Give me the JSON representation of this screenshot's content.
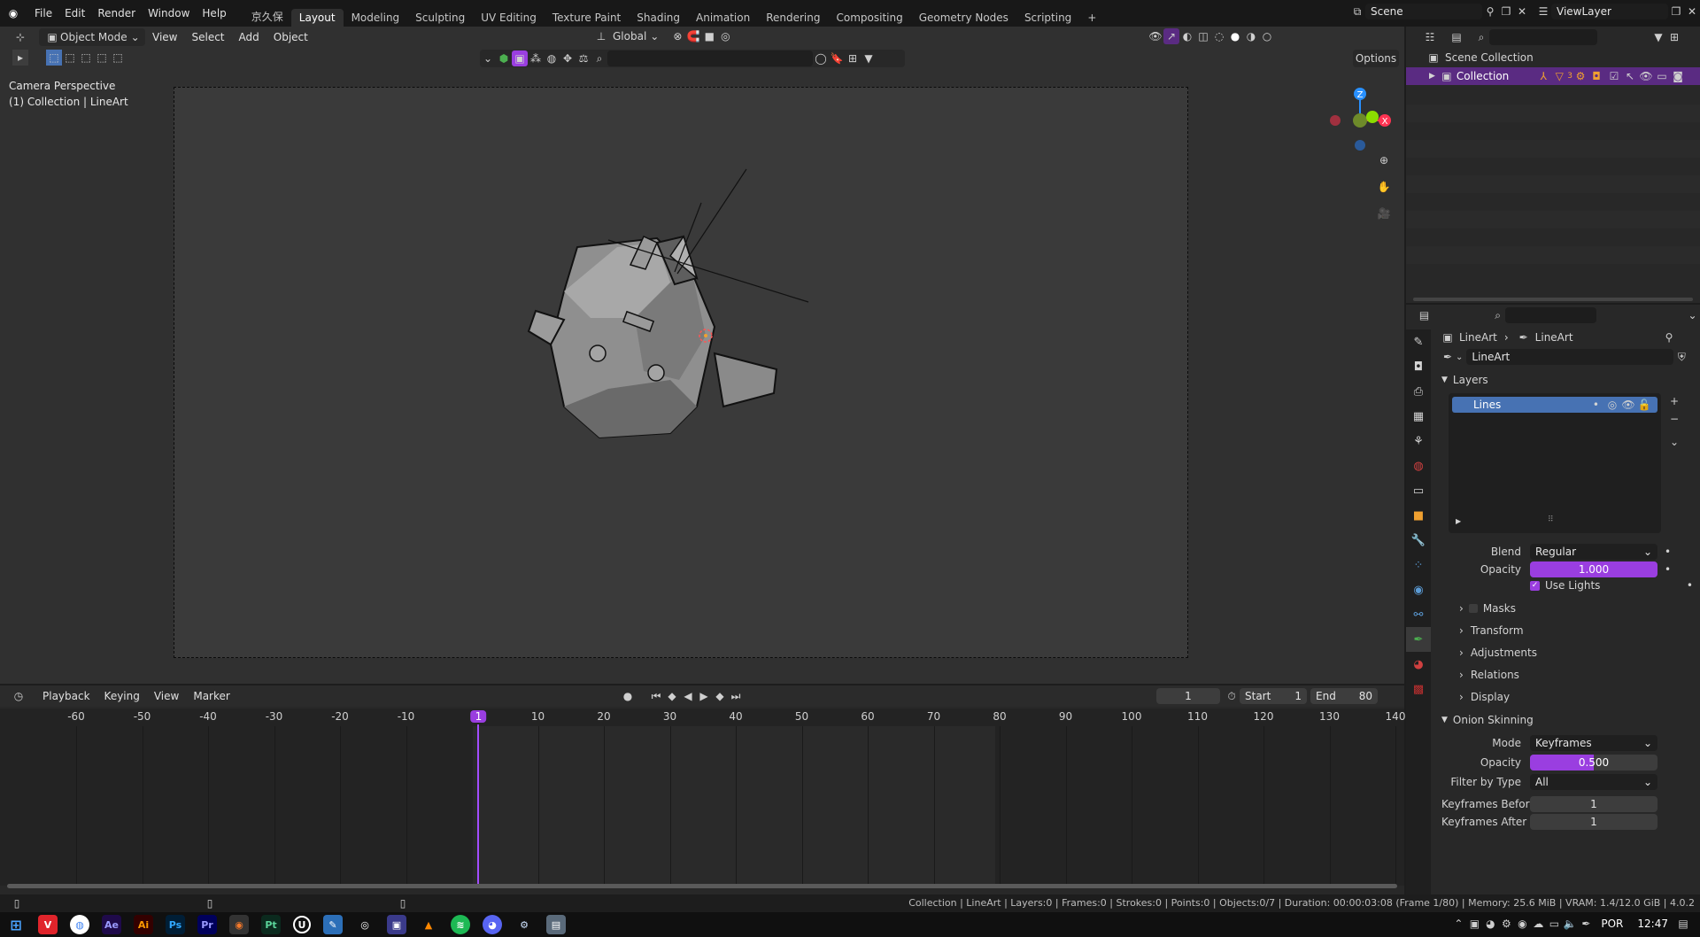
{
  "app": {
    "menu": [
      "File",
      "Edit",
      "Render",
      "Window",
      "Help"
    ],
    "workspaces": [
      "京久保",
      "Layout",
      "Modeling",
      "Sculpting",
      "UV Editing",
      "Texture Paint",
      "Shading",
      "Animation",
      "Rendering",
      "Compositing",
      "Geometry Nodes",
      "Scripting"
    ],
    "active_workspace": "Layout",
    "scene": "Scene",
    "view_layer": "ViewLayer"
  },
  "viewport": {
    "mode": "Object Mode",
    "menus": [
      "View",
      "Select",
      "Add",
      "Object"
    ],
    "orientation": "Global",
    "options_label": "Options",
    "overlay_text_line1": "Camera Perspective",
    "overlay_text_line2": "(1) Collection | LineArt",
    "gizmo_axes": [
      "Z",
      "X"
    ]
  },
  "timeline": {
    "menus": [
      "Playback",
      "Keying",
      "View",
      "Marker"
    ],
    "current_frame": "1",
    "start_label": "Start",
    "start_value": "1",
    "end_label": "End",
    "end_value": "80",
    "ticks": [
      "-60",
      "-50",
      "-40",
      "-30",
      "-20",
      "-10",
      "1",
      "10",
      "20",
      "30",
      "40",
      "50",
      "60",
      "70",
      "80",
      "90",
      "100",
      "110",
      "120",
      "130",
      "140"
    ],
    "playhead_frame": "1"
  },
  "outliner": {
    "root": "Scene Collection",
    "collection": "Collection",
    "badge": "3"
  },
  "properties": {
    "breadcrumb_object": "LineArt",
    "breadcrumb_data": "LineArt",
    "data_name": "LineArt",
    "layers_title": "Layers",
    "layer_name": "Lines",
    "blend_label": "Blend",
    "blend_value": "Regular",
    "opacity_label": "Opacity",
    "opacity_value": "1.000",
    "opacity_fraction": 1.0,
    "use_lights_label": "Use Lights",
    "use_lights": true,
    "subpanels": [
      "Masks",
      "Transform",
      "Adjustments",
      "Relations",
      "Display"
    ],
    "onion_title": "Onion Skinning",
    "mode_label": "Mode",
    "mode_value": "Keyframes",
    "onion_opacity_label": "Opacity",
    "onion_opacity_value": "0.500",
    "onion_opacity_fraction": 0.5,
    "filter_label": "Filter by Type",
    "filter_value": "All",
    "kf_before_label": "Keyframes Before",
    "kf_before_value": "1",
    "kf_after_label": "Keyframes After",
    "kf_after_value": "1"
  },
  "statusbar": {
    "text": "Collection | LineArt | Layers:0 | Frames:0 | Strokes:0 | Points:0 | Objects:0/7 | Duration: 00:00:03:08 (Frame 1/80) | Memory: 25.6 MiB | VRAM: 1.4/12.0 GiB | 4.0.2"
  },
  "taskbar": {
    "apps": [
      "Ae",
      "Ai",
      "Ps",
      "Pr",
      "Pt"
    ],
    "language": "POR",
    "time": "12:47"
  },
  "colors": {
    "accent_purple": "#9a3ee0",
    "selection_blue": "#4772b3",
    "playhead": "#a24dff",
    "axis_x": "#ff3352",
    "axis_y": "#8bdc00",
    "axis_z": "#2890ff"
  }
}
